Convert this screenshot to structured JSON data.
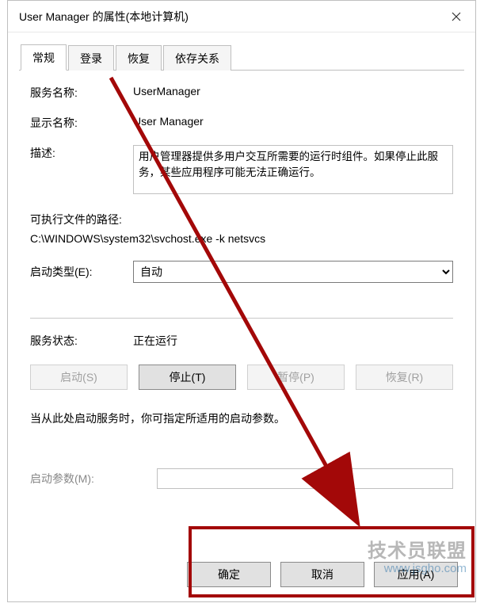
{
  "window": {
    "title": "User Manager 的属性(本地计算机)"
  },
  "tabs": [
    {
      "label": "常规",
      "active": true
    },
    {
      "label": "登录",
      "active": false
    },
    {
      "label": "恢复",
      "active": false
    },
    {
      "label": "依存关系",
      "active": false
    }
  ],
  "general": {
    "service_name_label": "服务名称:",
    "service_name": "UserManager",
    "display_name_label": "显示名称:",
    "display_name": "User Manager",
    "description_label": "描述:",
    "description": "用户管理器提供多用户交互所需要的运行时组件。如果停止此服务，某些应用程序可能无法正确运行。",
    "exec_path_label": "可执行文件的路径:",
    "exec_path": "C:\\WINDOWS\\system32\\svchost.exe -k netsvcs",
    "startup_type_label": "启动类型(E):",
    "startup_type": "自动",
    "status_label": "服务状态:",
    "status": "正在运行",
    "buttons": {
      "start": "启动(S)",
      "stop": "停止(T)",
      "pause": "暂停(P)",
      "resume": "恢复(R)"
    },
    "hint": "当从此处启动服务时，你可指定所适用的启动参数。",
    "start_params_label": "启动参数(M):",
    "start_params": ""
  },
  "dialog_buttons": {
    "ok": "确定",
    "cancel": "取消",
    "apply": "应用(A)"
  },
  "watermark": {
    "text": "技术员联盟",
    "url": "www.jsgho.com"
  }
}
